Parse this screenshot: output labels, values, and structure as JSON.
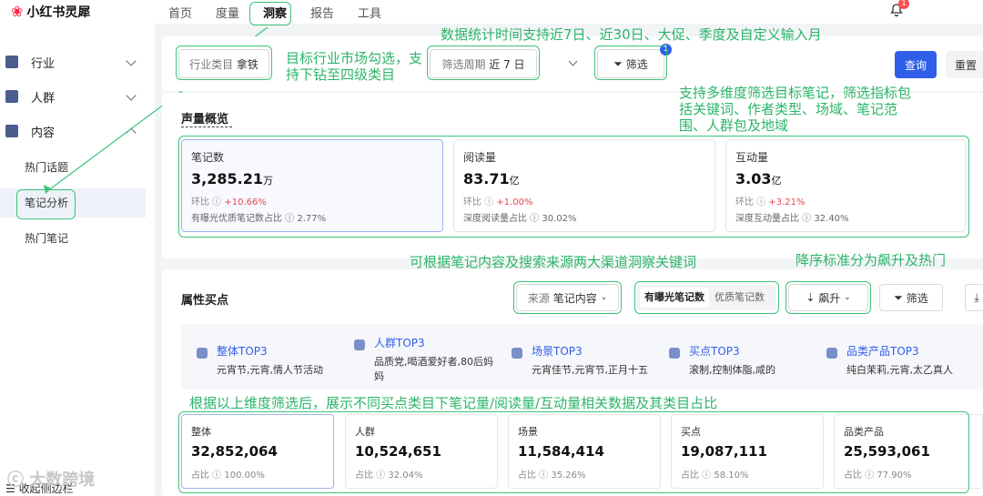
{
  "app": {
    "title": "小红书灵犀"
  },
  "nav": {
    "items": [
      "首页",
      "度量",
      "洞察",
      "报告",
      "工具"
    ]
  },
  "notifications": {
    "count": "1"
  },
  "sidebar": {
    "industry": "行业",
    "crowd": "人群",
    "content": "内容",
    "hot_topics": "热门话题",
    "note_analysis": "笔记分析",
    "hot_notes": "热门笔记",
    "collapse": "收起侧边栏"
  },
  "filters": {
    "industry_label": "行业类目",
    "industry_value": "拿铁",
    "period_label": "筛选周期",
    "period_value": "近 7 日",
    "filter_label": "筛选",
    "filter_badge": "1",
    "query": "查询",
    "reset": "重置"
  },
  "volume": {
    "title": "声量概览",
    "cards": [
      {
        "title": "笔记数",
        "value": "3,285.21",
        "unit": "万",
        "ratio_label": "环比",
        "ratio": "+10.66%",
        "sub": "有曝光优质笔记数占比 ⓘ 2.77%"
      },
      {
        "title": "阅读量",
        "value": "83.71",
        "unit": "亿",
        "ratio_label": "环比",
        "ratio": "+1.00%",
        "sub": "深度阅读量占比 ⓘ 30.02%"
      },
      {
        "title": "互动量",
        "value": "3.03",
        "unit": "亿",
        "ratio_label": "环比",
        "ratio": "+3.21%",
        "sub": "深度互动量占比 ⓘ 32.40%"
      }
    ]
  },
  "attributes": {
    "title": "属性买点",
    "source_label": "来源",
    "source_value": "笔记内容",
    "toggle_exposure": "有曝光笔记数",
    "toggle_quality": "优质笔记数",
    "sort_value": "飙升",
    "filter_label": "筛选",
    "top3": [
      {
        "head": "整体TOP3",
        "desc": "元宵节,元宵,情人节活动"
      },
      {
        "head": "人群TOP3",
        "desc": "品质党,喝酒爱好者,80后妈妈"
      },
      {
        "head": "场景TOP3",
        "desc": "元宵佳节,元宵节,正月十五"
      },
      {
        "head": "买点TOP3",
        "desc": "滚制,控制体脂,咸的"
      },
      {
        "head": "品类产品TOP3",
        "desc": "纯白茉莉,元宵,太乙真人"
      }
    ],
    "cards": [
      {
        "title": "整体",
        "value": "32,852,064",
        "share": "占比 ⓘ 100.00%"
      },
      {
        "title": "人群",
        "value": "10,524,651",
        "share": "占比 ⓘ 32.04%"
      },
      {
        "title": "场景",
        "value": "11,584,414",
        "share": "占比 ⓘ 35.26%"
      },
      {
        "title": "买点",
        "value": "19,087,111",
        "share": "占比 ⓘ 58.10%"
      },
      {
        "title": "品类产品",
        "value": "25,593,061",
        "share": "占比 ⓘ 77.90%"
      }
    ]
  },
  "annotations": {
    "a1": "目标行业市场勾选，支持下钻至四级类目",
    "a2": "数据统计时间支持近7日、近30日、大促、季度及自定义输入月",
    "a3": "支持多维度筛选目标笔记，筛选指标包括关键词、作者类型、场域、笔记范围、人群包及地域",
    "a4": "可根据笔记内容及搜索来源两大渠道洞察关键词",
    "a5": "降序标准分为飙升及热门",
    "a6": "根据以上维度筛选后，展示不同买点类目下笔记量/阅读量/互动量相关数据及其类目占比"
  },
  "watermark": "大数跨境",
  "colors": {
    "annotation": "#3cc37a",
    "primary": "#2f5ee8",
    "positive": "#e5484d"
  }
}
